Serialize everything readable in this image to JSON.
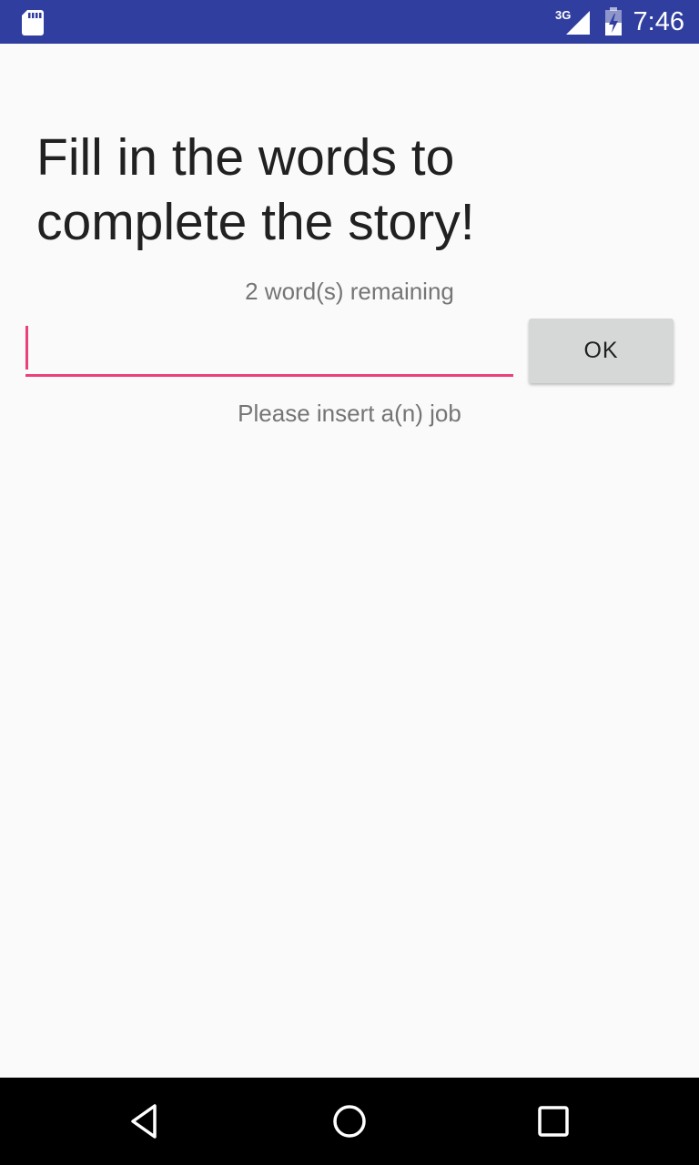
{
  "status_bar": {
    "time": "7:46",
    "network": "3G",
    "background_color": "#303f9f"
  },
  "content": {
    "headline": "Fill in the words to complete the story!",
    "remaining": "2 word(s) remaining",
    "input": {
      "value": "",
      "placeholder": ""
    },
    "ok_label": "OK",
    "hint": "Please insert a(n) job",
    "accent_color": "#ec407a"
  },
  "nav_bar": {
    "icons": [
      "back-icon",
      "home-icon",
      "recents-icon"
    ]
  }
}
